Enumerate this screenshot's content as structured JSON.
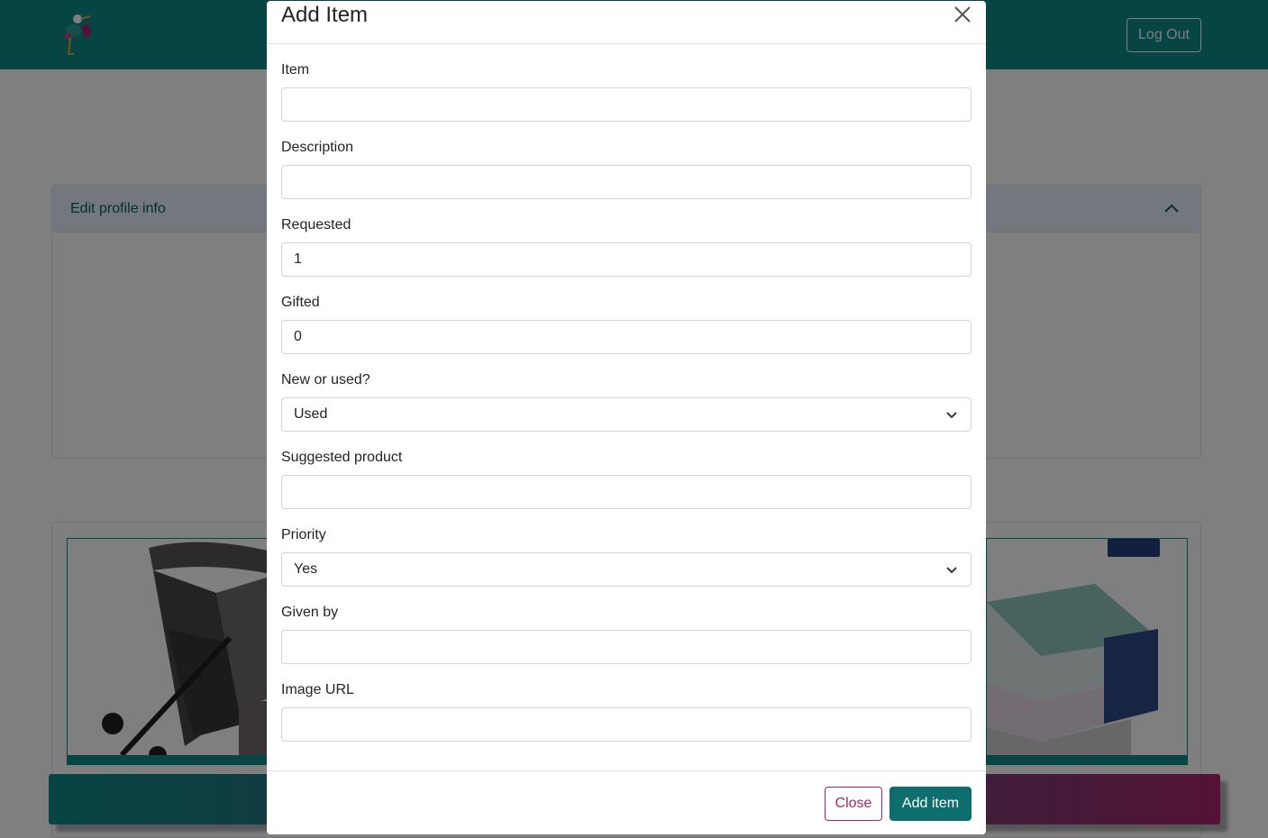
{
  "navbar": {
    "logo_icon": "stork-logo-icon",
    "logout_label": "Log Out",
    "color": "#0e8a89"
  },
  "accordion": {
    "title": "Edit profile info",
    "chevron_icon": "chevron-up-icon"
  },
  "modal": {
    "title": "Add Item",
    "close_icon": "close-icon",
    "fields": {
      "item": {
        "label": "Item",
        "value": ""
      },
      "description": {
        "label": "Description",
        "value": ""
      },
      "requested": {
        "label": "Requested",
        "value": "1"
      },
      "gifted": {
        "label": "Gifted",
        "value": "0"
      },
      "condition": {
        "label": "New or used?",
        "value": "Used"
      },
      "suggested_product": {
        "label": "Suggested product",
        "value": ""
      },
      "priority": {
        "label": "Priority",
        "value": "Yes"
      },
      "given_by": {
        "label": "Given by",
        "value": ""
      },
      "image_url": {
        "label": "Image URL",
        "value": ""
      }
    },
    "close_label": "Close",
    "add_label": "Add item"
  },
  "colors": {
    "primary": "#0e6e6d",
    "accent": "#a8246c"
  }
}
